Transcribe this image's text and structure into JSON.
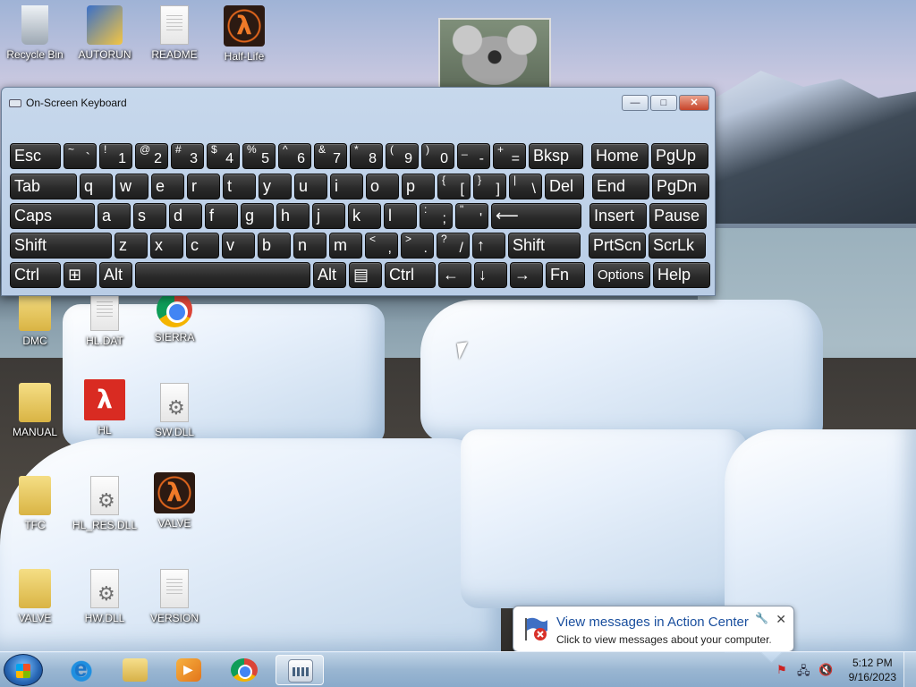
{
  "desktop": {
    "icons": [
      {
        "label": "Recycle Bin",
        "icon": "recycle-bin-icon"
      },
      {
        "label": "AUTORUN",
        "icon": "autorun-setup-icon"
      },
      {
        "label": "README",
        "icon": "text-file-icon"
      },
      {
        "label": "Half-Life",
        "icon": "half-life-shortcut-icon"
      },
      {
        "label": "DMC",
        "icon": "folder-icon"
      },
      {
        "label": "HL.DAT",
        "icon": "blank-file-icon"
      },
      {
        "label": "SIERRA",
        "icon": "chrome-shortcut-icon"
      },
      {
        "label": "MANUAL",
        "icon": "folder-icon"
      },
      {
        "label": "HL",
        "icon": "half-life-icon"
      },
      {
        "label": "SW.DLL",
        "icon": "dll-file-icon"
      },
      {
        "label": "TFC",
        "icon": "folder-icon"
      },
      {
        "label": "HL_RES.DLL",
        "icon": "dll-file-icon"
      },
      {
        "label": "VALVE",
        "icon": "half-life-icon"
      },
      {
        "label": "VALVE",
        "icon": "folder-icon"
      },
      {
        "label": "HW.DLL",
        "icon": "dll-file-icon"
      },
      {
        "label": "VERSION",
        "icon": "text-file-icon"
      }
    ]
  },
  "osk": {
    "title": "On-Screen Keyboard",
    "controls": {
      "minimize": "—",
      "maximize": "□",
      "close": "✕"
    },
    "rows": [
      [
        {
          "label": "Esc"
        },
        {
          "sup": "~",
          "main": "`"
        },
        {
          "sup": "!",
          "main": "1"
        },
        {
          "sup": "@",
          "main": "2"
        },
        {
          "sup": "#",
          "main": "3"
        },
        {
          "sup": "$",
          "main": "4"
        },
        {
          "sup": "%",
          "main": "5"
        },
        {
          "sup": "^",
          "main": "6"
        },
        {
          "sup": "&",
          "main": "7"
        },
        {
          "sup": "*",
          "main": "8"
        },
        {
          "sup": "(",
          "main": "9"
        },
        {
          "sup": ")",
          "main": "0"
        },
        {
          "sup": "_",
          "main": "-"
        },
        {
          "sup": "+",
          "main": "="
        },
        {
          "label": "Bksp"
        },
        {
          "label": "Home"
        },
        {
          "label": "PgUp"
        }
      ],
      [
        {
          "label": "Tab"
        },
        {
          "label": "q"
        },
        {
          "label": "w"
        },
        {
          "label": "e"
        },
        {
          "label": "r"
        },
        {
          "label": "t"
        },
        {
          "label": "y"
        },
        {
          "label": "u"
        },
        {
          "label": "i"
        },
        {
          "label": "o"
        },
        {
          "label": "p"
        },
        {
          "sup": "{",
          "main": "["
        },
        {
          "sup": "}",
          "main": "]"
        },
        {
          "sup": "|",
          "main": "\\"
        },
        {
          "label": "Del"
        },
        {
          "label": "End"
        },
        {
          "label": "PgDn"
        }
      ],
      [
        {
          "label": "Caps"
        },
        {
          "label": "a"
        },
        {
          "label": "s"
        },
        {
          "label": "d"
        },
        {
          "label": "f"
        },
        {
          "label": "g"
        },
        {
          "label": "h"
        },
        {
          "label": "j"
        },
        {
          "label": "k"
        },
        {
          "label": "l"
        },
        {
          "sup": ":",
          "main": ";"
        },
        {
          "sup": "\"",
          "main": "'"
        },
        {
          "label": "⟵"
        },
        {
          "label": "Insert"
        },
        {
          "label": "Pause"
        }
      ],
      [
        {
          "label": "Shift"
        },
        {
          "label": "z"
        },
        {
          "label": "x"
        },
        {
          "label": "c"
        },
        {
          "label": "v"
        },
        {
          "label": "b"
        },
        {
          "label": "n"
        },
        {
          "label": "m"
        },
        {
          "sup": "<",
          "main": ","
        },
        {
          "sup": ">",
          "main": "."
        },
        {
          "sup": "?",
          "main": "/"
        },
        {
          "label": "↑"
        },
        {
          "label": "Shift"
        },
        {
          "label": "PrtScn"
        },
        {
          "label": "ScrLk"
        }
      ],
      [
        {
          "label": "Ctrl"
        },
        {
          "label": "⊞"
        },
        {
          "label": "Alt"
        },
        {
          "label": ""
        },
        {
          "label": "Alt"
        },
        {
          "label": "▤"
        },
        {
          "label": "Ctrl"
        },
        {
          "label": "←"
        },
        {
          "label": "↓"
        },
        {
          "label": "→"
        },
        {
          "label": "Fn"
        },
        {
          "label": "Options"
        },
        {
          "label": "Help"
        }
      ]
    ]
  },
  "notification": {
    "title": "View messages in Action Center",
    "text": "Click to view messages about your computer.",
    "close": "✕",
    "pin": "🔧"
  },
  "taskbar": {
    "apps": [
      {
        "name": "internet-explorer"
      },
      {
        "name": "windows-explorer"
      },
      {
        "name": "media-player"
      },
      {
        "name": "chrome"
      },
      {
        "name": "on-screen-keyboard",
        "active": true
      }
    ],
    "tray": {
      "flag": "⚑",
      "network": "🖧",
      "volume": "🔇"
    },
    "clock": {
      "time": "5:12 PM",
      "date": "9/16/2023"
    }
  },
  "colors": {
    "accent": "#1a4f9e",
    "key_face": "#2a2a2a",
    "window_frame": "#b9cde6"
  }
}
